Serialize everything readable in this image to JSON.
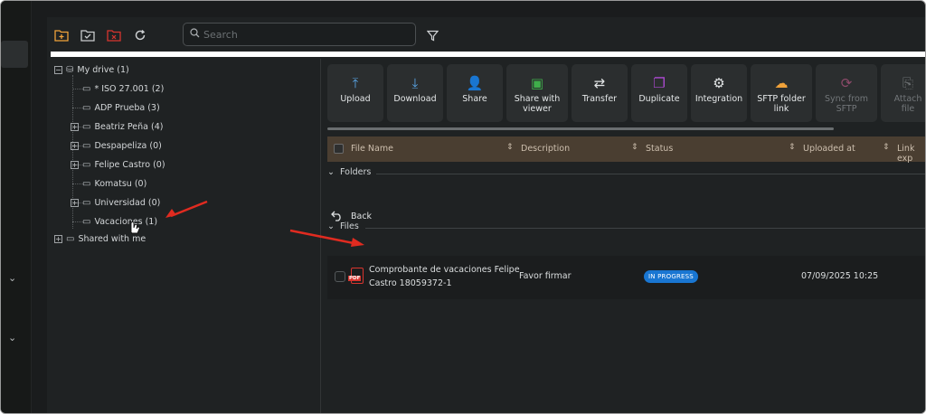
{
  "toolbar": {
    "icons": [
      "new-folder-icon",
      "folder-check-icon",
      "folder-remove-icon",
      "refresh-icon"
    ],
    "search_placeholder": "Search",
    "filter_icon": "filter-icon"
  },
  "tree": {
    "root": "My drive (1)",
    "items": [
      {
        "label": "* ISO 27.001 (2)",
        "expandable": false
      },
      {
        "label": "ADP Prueba (3)",
        "expandable": false
      },
      {
        "label": "Beatriz Peña (4)",
        "expandable": true
      },
      {
        "label": "Despapeliza (0)",
        "expandable": true
      },
      {
        "label": "Felipe Castro (0)",
        "expandable": true
      },
      {
        "label": "Komatsu (0)",
        "expandable": false
      },
      {
        "label": "Universidad (0)",
        "expandable": true
      },
      {
        "label": "Vacaciones (1)",
        "expandable": false
      }
    ],
    "shared": "Shared with me"
  },
  "actions": [
    {
      "line1": "Upload",
      "line2": "",
      "icon": "upload-icon",
      "dim": false
    },
    {
      "line1": "Download",
      "line2": "",
      "icon": "download-icon",
      "dim": false
    },
    {
      "line1": "Share",
      "line2": "",
      "icon": "share-user-icon",
      "dim": false
    },
    {
      "line1": "Share with",
      "line2": "viewer",
      "icon": "share-viewer-icon",
      "dim": false
    },
    {
      "line1": "Transfer",
      "line2": "",
      "icon": "transfer-icon",
      "dim": false
    },
    {
      "line1": "Duplicate",
      "line2": "",
      "icon": "duplicate-icon",
      "dim": false
    },
    {
      "line1": "Integration",
      "line2": "",
      "icon": "integration-icon",
      "dim": false
    },
    {
      "line1": "SFTP folder",
      "line2": "link",
      "icon": "sftp-link-icon",
      "dim": false
    },
    {
      "line1": "Sync from",
      "line2": "SFTP",
      "icon": "sync-icon",
      "dim": true
    },
    {
      "line1": "Attach",
      "line2": "file",
      "icon": "attach-icon",
      "dim": true
    }
  ],
  "table": {
    "columns": [
      "File Name",
      "Description",
      "Status",
      "Uploaded at",
      "Link exp"
    ],
    "folders_label": "Folders",
    "back_label": "Back",
    "files_label": "Files",
    "rows": [
      {
        "name_line1": "Comprobante de vacaciones Felipe",
        "name_line2": "Castro 18059372-1",
        "description": "Favor firmar",
        "status": "IN PROGRESS",
        "uploaded_at": "07/09/2025 10:25"
      }
    ]
  },
  "colors": {
    "accent_orange": "#f0a23a",
    "status_blue": "#1976d2",
    "pdf_red": "#d8352f",
    "annotation_arrow": "#e02b20"
  }
}
